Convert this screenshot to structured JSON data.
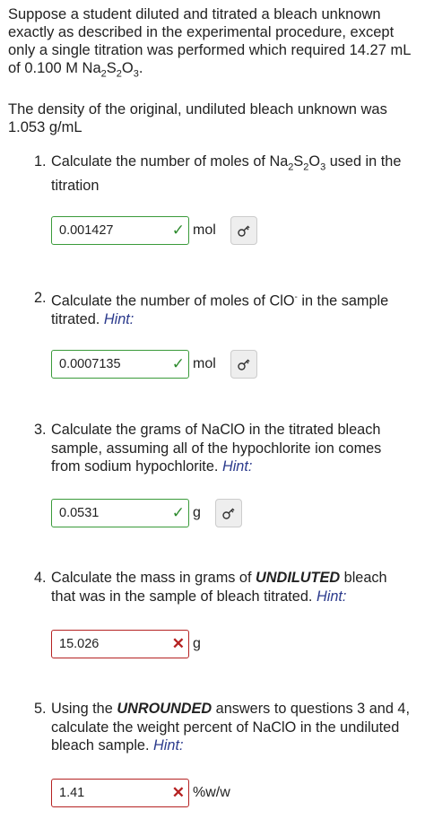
{
  "intro": {
    "p1_a": "Suppose a student diluted and titrated a bleach unknown exactly as described in the experimental procedure, except only a single titration was performed which required 14.27 mL of 0.100 M Na",
    "p1_sub1": "2",
    "p1_b": "S",
    "p1_sub2": "2",
    "p1_c": "O",
    "p1_sub3": "3",
    "p1_d": ".",
    "p2": "The density of the original, undiluted bleach unknown was 1.053 g/mL"
  },
  "questions": [
    {
      "num": "1.",
      "text_a": "Calculate the number of moles of Na",
      "sub1": "2",
      "text_b": "S",
      "sub2": "2",
      "text_c": "O",
      "sub3": "3",
      "text_d": " used in the titration",
      "answer": "0.001427",
      "status": "correct",
      "unit": "mol"
    },
    {
      "num": "2.",
      "text_a": "Calculate the number of moles of ClO",
      "sup": "-",
      "text_b": " in the sample titrated. ",
      "hint": "Hint:",
      "answer": "0.0007135",
      "status": "correct",
      "unit": "mol"
    },
    {
      "num": "3.",
      "text": "Calculate the grams of NaClO in the titrated bleach sample, assuming all of the hypochlorite ion comes from sodium hypochlorite. ",
      "hint": "Hint:",
      "answer": "0.0531",
      "status": "correct",
      "unit": "g"
    },
    {
      "num": "4.",
      "text_a": "Calculate the mass in grams of ",
      "emph": "UNDILUTED",
      "text_b": " bleach that was in the sample of bleach titrated. ",
      "hint": "Hint:",
      "answer": "15.026",
      "status": "incorrect",
      "unit": "g"
    },
    {
      "num": "5.",
      "text_a": "Using the ",
      "emph": "UNROUNDED",
      "text_b": " answers to questions 3 and 4, calculate the weight percent of NaClO in the undiluted bleach sample. ",
      "hint": "Hint:",
      "answer": "1.41",
      "status": "incorrect",
      "unit": "%w/w"
    }
  ],
  "icons": {
    "correct": "checkmark-icon",
    "incorrect": "x-mark-icon",
    "key": "key-icon"
  },
  "colors": {
    "correct": "#3a9a3a",
    "incorrect": "#b52222",
    "hint": "#2b3a8c"
  },
  "marks": {
    "correct": "✓",
    "incorrect": "✕"
  }
}
